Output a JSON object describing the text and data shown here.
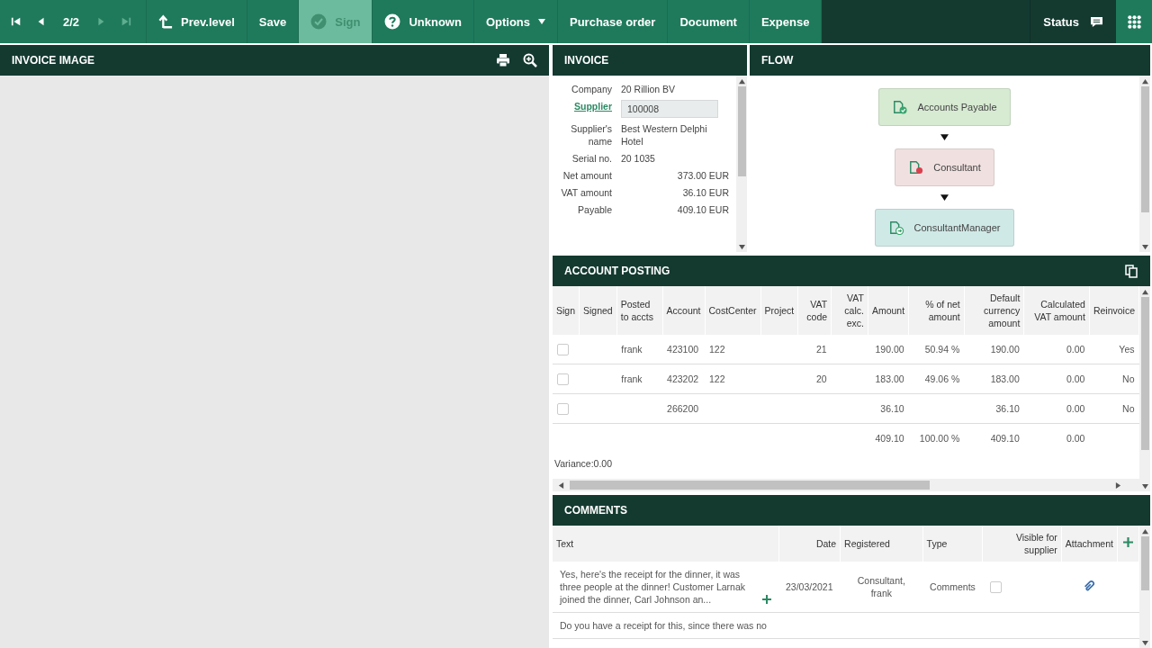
{
  "toolbar": {
    "nav": [
      {
        "kind": "first",
        "disabled": false
      },
      {
        "kind": "prev",
        "disabled": false
      },
      {
        "kind": "counter",
        "label": "2/2"
      },
      {
        "kind": "next",
        "disabled": true
      },
      {
        "kind": "last",
        "disabled": true
      }
    ],
    "buttons": [
      {
        "kind": "up",
        "label": "Prev.level",
        "disabled": false
      },
      {
        "kind": "plain",
        "label": "Save",
        "disabled": false
      },
      {
        "kind": "check",
        "label": "Sign",
        "disabled": true
      },
      {
        "kind": "question",
        "label": "Unknown",
        "disabled": false
      },
      {
        "kind": "dropdown",
        "label": "Options",
        "disabled": false
      },
      {
        "kind": "plain",
        "label": "Purchase order",
        "disabled": false
      },
      {
        "kind": "plain",
        "label": "Document",
        "disabled": false
      },
      {
        "kind": "plain",
        "label": "Expense",
        "disabled": false
      }
    ],
    "status": "Status"
  },
  "invoice_image": {
    "title": "INVOICE IMAGE"
  },
  "invoice": {
    "title": "INVOICE",
    "fields": [
      {
        "label": "Company",
        "value": "20 Rillion BV",
        "kind": "text"
      },
      {
        "label": "Supplier",
        "value": "100008",
        "kind": "field"
      },
      {
        "label": "Supplier's name",
        "value": "Best Western Delphi Hotel",
        "kind": "text"
      },
      {
        "label": "Serial no.",
        "value": "20 1035",
        "kind": "text"
      },
      {
        "label": "Net amount",
        "value": "373.00 EUR",
        "kind": "amount"
      },
      {
        "label": "VAT amount",
        "value": "36.10 EUR",
        "kind": "amount"
      },
      {
        "label": "Payable",
        "value": "409.10 EUR",
        "kind": "amount"
      }
    ]
  },
  "flow": {
    "title": "FLOW",
    "steps": [
      {
        "label": "Accounts Payable",
        "kind": "done",
        "color": "#d7ead2"
      },
      {
        "label": "Consultant",
        "kind": "pending",
        "color": "#f0e1e0"
      },
      {
        "label": "ConsultantManager",
        "kind": "next",
        "color": "#cfe9e6"
      }
    ]
  },
  "account_posting": {
    "title": "ACCOUNT POSTING",
    "columns": [
      "Sign",
      "Signed",
      "Posted to accts",
      "Account",
      "CostCenter",
      "Project",
      "VAT code",
      "VAT calc. exc.",
      "Amount",
      "% of net amount",
      "Default currency amount",
      "Calculated VAT amount",
      "Reinvoice"
    ],
    "rows": [
      {
        "checked": false,
        "cells": [
          "",
          "",
          "frank",
          "423100",
          "122",
          "",
          "21",
          "",
          "190.00",
          "50.94 %",
          "190.00",
          "0.00",
          "Yes"
        ]
      },
      {
        "checked": false,
        "cells": [
          "",
          "",
          "frank",
          "423202",
          "122",
          "",
          "20",
          "",
          "183.00",
          "49.06 %",
          "183.00",
          "0.00",
          "No"
        ]
      },
      {
        "checked": false,
        "cells": [
          "",
          "",
          "",
          "266200",
          "",
          "",
          "",
          "",
          "36.10",
          "",
          "36.10",
          "0.00",
          "No"
        ]
      },
      {
        "cells": [
          "",
          "",
          "",
          "",
          "",
          "",
          "",
          "",
          "409.10",
          "100.00 %",
          "409.10",
          "0.00",
          ""
        ]
      }
    ],
    "variance": "Variance:0.00"
  },
  "comments": {
    "title": "COMMENTS",
    "columns": [
      "Text",
      "Date",
      "Registered",
      "Type",
      "Visible for supplier",
      "Attachment"
    ],
    "rows": [
      {
        "text": "Yes, here's the receipt for the dinner, it was three people at the dinner! Customer Larnak joined the dinner, Carl Johnson an...",
        "date": "23/03/2021",
        "registered": "Consultant, frank",
        "type": "Comments",
        "visible": false,
        "attachment": true
      },
      {
        "text": "Do you have a receipt for this, since there was no"
      }
    ]
  }
}
